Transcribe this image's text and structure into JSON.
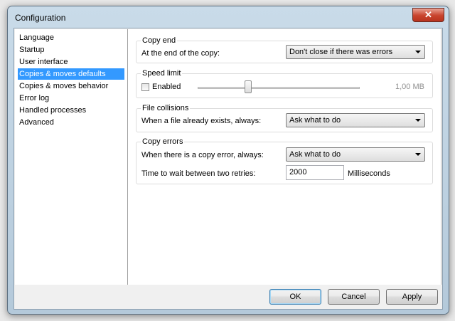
{
  "window": {
    "title": "Configuration",
    "close_glyph": "✕"
  },
  "sidebar": {
    "items": [
      {
        "label": "Language"
      },
      {
        "label": "Startup"
      },
      {
        "label": "User interface"
      },
      {
        "label": "Copies & moves defaults",
        "selected": true
      },
      {
        "label": "Copies & moves behavior"
      },
      {
        "label": "Error log"
      },
      {
        "label": "Handled processes"
      },
      {
        "label": "Advanced"
      }
    ]
  },
  "copy_end": {
    "title": "Copy end",
    "label": "At the end of the copy:",
    "value": "Don't close if there was errors"
  },
  "speed_limit": {
    "title": "Speed limit",
    "enabled_label": "Enabled",
    "enabled": false,
    "value_text": "1,00 MB",
    "slider_level": 0.31
  },
  "file_collisions": {
    "title": "File collisions",
    "label": "When a file already exists, always:",
    "value": "Ask what to do"
  },
  "copy_errors": {
    "title": "Copy errors",
    "label": "When there is a copy error, always:",
    "value": "Ask what to do",
    "retry_label": "Time to wait between two retries:",
    "retry_value": "2000",
    "retry_unit": "Milliseconds"
  },
  "buttons": {
    "ok": "OK",
    "cancel": "Cancel",
    "apply": "Apply"
  },
  "colors": {
    "selection": "#3399ff",
    "default_button_border": "#3c7fb1"
  }
}
